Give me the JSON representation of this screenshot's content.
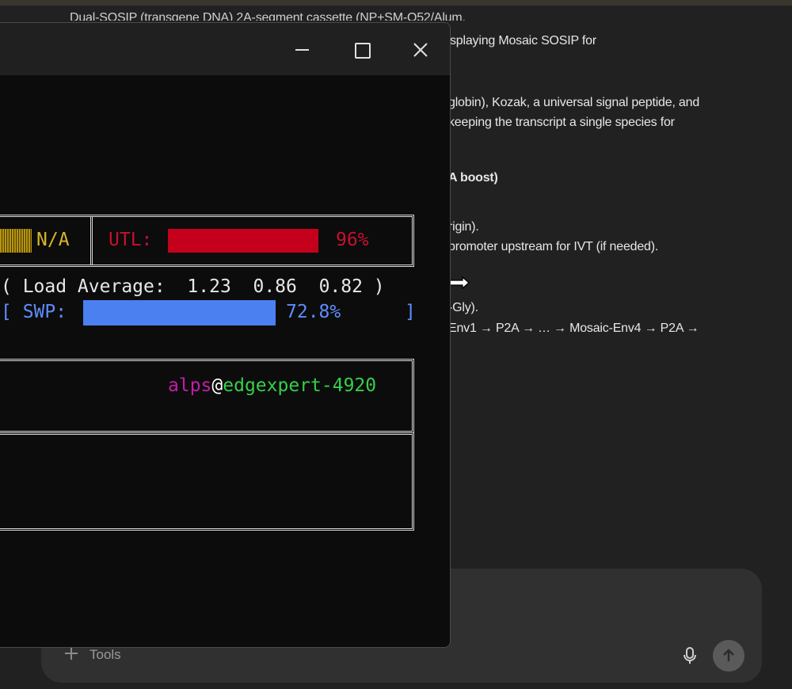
{
  "chat": {
    "lines": [
      "Dual-SOSIP (transgene DNA) 2A-segment cassette (NP+SM-O52/Alum.",
      "splaying Mosaic SOSIP for",
      "globin), Kozak, a universal signal peptide, and",
      "keeping the transcript a single species for",
      "A boost)",
      "rigin).",
      "promoter upstream for IVT (if needed).",
      "-Gly).",
      "Env1 → P2A → … → Mosaic-Env4 → P2A →"
    ],
    "composer": {
      "tools_label": "Tools"
    }
  },
  "terminal": {
    "na_label": "N/A",
    "utl_label": "UTL:",
    "utl_percent_text": "96%",
    "utl_fraction": 0.96,
    "load_average_text": "( Load Average:  1.23  0.86  0.82 )",
    "swp_label": "[ SWP:",
    "swp_percent_text": "72.8%",
    "swp_fraction": 0.728,
    "swp_close": "]",
    "host_user": "alps",
    "host_at": "@",
    "host_name": "edgexpert-4920"
  },
  "colors": {
    "utl": "#c5001c",
    "swp": "#4b80f0",
    "na": "#d9b628",
    "user": "#c21ea7",
    "host": "#34d04a"
  },
  "icons": [
    "minimize-icon",
    "maximize-icon",
    "close-icon",
    "plus-icon",
    "microphone-icon",
    "arrow-up-icon",
    "resize-horizontal-cursor-icon"
  ]
}
